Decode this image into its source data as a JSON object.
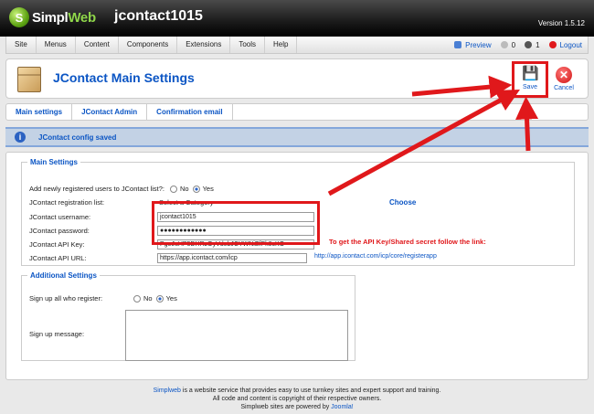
{
  "header": {
    "logo_text_left": "Simpl",
    "logo_text_right": "Web",
    "site_name": "jcontact1015",
    "version": "Version 1.5.12"
  },
  "menu": {
    "items": [
      "Site",
      "Menus",
      "Content",
      "Components",
      "Extensions",
      "Tools",
      "Help"
    ],
    "preview": "Preview",
    "messages_count": "0",
    "users_count": "1",
    "logout": "Logout"
  },
  "toolbar": {
    "title": "JContact Main Settings",
    "save_label": "Save",
    "cancel_label": "Cancel"
  },
  "submenu": {
    "items": [
      "Main settings",
      "JContact Admin",
      "Confirmation email"
    ]
  },
  "message": {
    "text": "JContact config saved"
  },
  "main_settings": {
    "legend": "Main Settings",
    "add_users_label": "Add newly registered users to JContact list?:",
    "no_label": "No",
    "yes_label": "Yes",
    "registration_list_label": "JContact registration list:",
    "registration_list_value": "Select a Category",
    "choose_link": "Choose",
    "username_label": "JContact username:",
    "username_value": "jcontact1015",
    "password_label": "JContact password:",
    "password_value": "●●●●●●●●●●●●",
    "api_key_label": "JContact API Key:",
    "api_key_value": "PgoJuHP5DHRzOyVdebJCYWNiEfPk8cKO",
    "api_note": "To get the API Key/Shared secret follow the link:",
    "api_url_label": "JContact API URL:",
    "api_url_value": "https://app.icontact.com/icp",
    "api_link": "http://app.icontact.com/icp/core/registerapp"
  },
  "additional_settings": {
    "legend": "Additional Settings",
    "signup_label": "Sign up all who register:",
    "no_label": "No",
    "yes_label": "Yes",
    "message_label": "Sign up message:"
  },
  "footer": {
    "brand": "Simplweb",
    "line1_rest": " is a website service that provides easy to use turnkey sites and expert support and training.",
    "line2": "All code and content is copyright of their respective owners.",
    "line3_prefix": "Simplweb sites are powered by ",
    "joomla": "Joomla!"
  },
  "colors": {
    "accent": "#0b55c4",
    "highlight": "#e0181b",
    "message_bg": "#c3d2e5"
  }
}
